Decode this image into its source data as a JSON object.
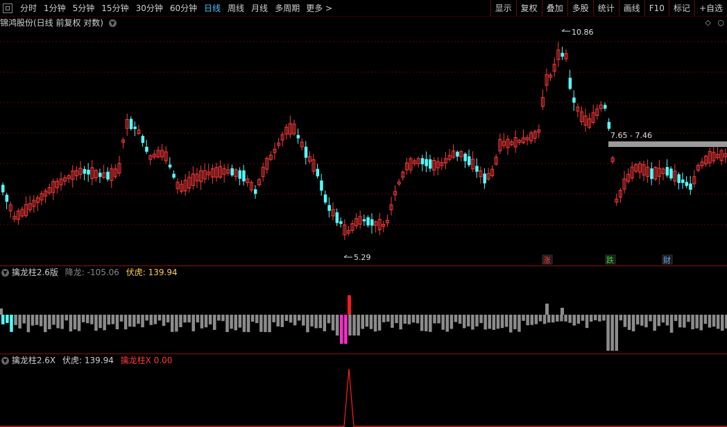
{
  "toolbar": {
    "periods": [
      "分时",
      "1分钟",
      "5分钟",
      "15分钟",
      "30分钟",
      "60分钟",
      "日线",
      "周线",
      "月线",
      "多周期"
    ],
    "active_period": "日线",
    "more_label": "更多",
    "right_tools": [
      "显示",
      "复权",
      "叠加",
      "多股",
      "统计",
      "画线",
      "F10",
      "标记",
      "+自选"
    ]
  },
  "main_chart": {
    "title": "锦鸿股份(日线 前复权 对数)",
    "high_label": "10.86",
    "low_label": "5.29",
    "range_label": "7.65 - 7.46",
    "markers": [
      {
        "text": "涨",
        "color": "#ff4040"
      },
      {
        "text": "跌",
        "color": "#33dd33"
      },
      {
        "text": "财",
        "color": "#66aaff"
      }
    ]
  },
  "indicator1": {
    "name": "擒龙柱2.6版",
    "label1": "降龙:",
    "value1": "-105.06",
    "label2": "伏虎:",
    "value2": "139.94"
  },
  "indicator2": {
    "name": "擒龙柱2.6X",
    "label1": "伏虎:",
    "value1": "139.94",
    "label2": "擒龙柱X",
    "value2": "0.00"
  },
  "colors": {
    "up": "#ff3b3b",
    "down": "#54ffff",
    "gray_bar": "#8c8c8c",
    "magenta_bar": "#ff2bd0",
    "red_bar": "#ff1a1a",
    "divider": "#8a1010"
  }
}
